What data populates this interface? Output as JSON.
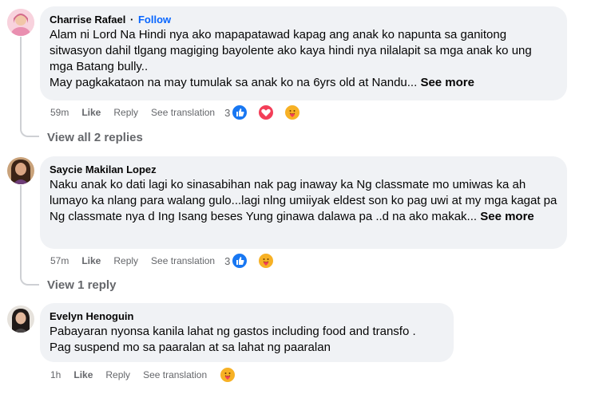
{
  "comments": [
    {
      "author": "Charrise Rafael",
      "follow_label": "Follow",
      "text": "Alam ni Lord Na Hindi nya ako mapapatawad kapag ang anak ko napunta sa ganitong sitwasyon dahil tlgang magiging bayolente ako kaya hindi nya nilalapit sa mga anak ko ung mga Batang bully..",
      "text2": "May pagkakataon na may tumulak sa anak ko na 6yrs old at Nandu...",
      "see_more": "See more",
      "time": "59m",
      "like": "Like",
      "reply": "Reply",
      "translate": "See translation",
      "reaction_count": "3",
      "reactions": [
        "like-reaction-icon",
        "love-reaction-icon",
        "care-reaction-icon"
      ],
      "view_replies": "View all 2 replies"
    },
    {
      "author": "Saycie Makilan Lopez",
      "text": "Naku anak ko dati lagi ko sinasabihan nak pag inaway ka Ng classmate mo umiwas ka ah lumayo ka nlang para walang gulo...lagi nlng umiiyak eldest son ko pag uwi at my mga kagat pa Ng classmate nya d Ing Isang beses Yung ginawa dalawa pa ..d na ako makak...",
      "see_more": "See more",
      "time": "57m",
      "like": "Like",
      "reply": "Reply",
      "translate": "See translation",
      "reaction_count": "3",
      "reactions": [
        "like-reaction-icon",
        "care-reaction-icon"
      ],
      "view_replies": "View 1 reply"
    },
    {
      "author": "Evelyn Henoguin",
      "text": "Pabayaran nyonsa kanila lahat ng gastos including food and transfo .",
      "text2": "Pag suspend mo sa paaralan at sa lahat ng paaralan",
      "time": "1h",
      "like": "Like",
      "reply": "Reply",
      "translate": "See translation",
      "reactions": [
        "care-reaction-icon"
      ]
    }
  ],
  "colors": {
    "bubble": "#f0f2f5",
    "link_blue": "#0866ff",
    "secondary_text": "#65676b",
    "like_blue": "#1877f2",
    "love_red": "#f33e58",
    "care_yellow": "#f7b125"
  }
}
